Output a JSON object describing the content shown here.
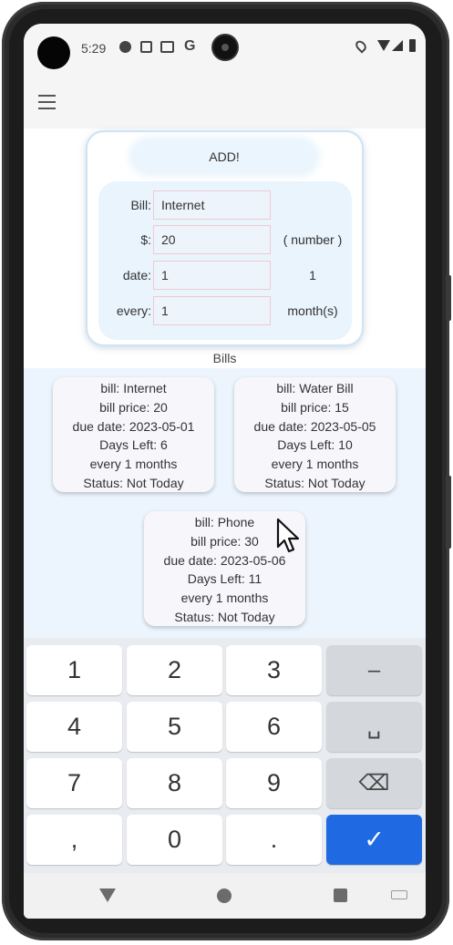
{
  "status_bar": {
    "time": "5:29",
    "google_glyph": "G"
  },
  "app_bar": {
    "menu_icon": "hamburger-menu-icon"
  },
  "add_form": {
    "button_label": "ADD!",
    "rows": [
      {
        "label": "Bill:",
        "value": "Internet",
        "hint": ""
      },
      {
        "label": "$:",
        "value": "20",
        "hint": "( number )"
      },
      {
        "label": "date:",
        "value": "1",
        "hint": "1"
      },
      {
        "label": "every:",
        "value": "1",
        "hint": "month(s)"
      }
    ]
  },
  "bills_title": "Bills",
  "bills": [
    {
      "name": "bill: Internet",
      "price": "bill price: 20",
      "due": "due date: 2023-05-01",
      "days_left": "Days Left: 6",
      "every": "every 1 months",
      "status": "Status: Not Today"
    },
    {
      "name": "bill: Water Bill",
      "price": "bill price: 15",
      "due": "due date: 2023-05-05",
      "days_left": "Days Left: 10",
      "every": "every 1 months",
      "status": "Status: Not Today"
    },
    {
      "name": "bill: Phone",
      "price": "bill price: 30",
      "due": "due date: 2023-05-06",
      "days_left": "Days Left: 11",
      "every": "every 1 months",
      "status": "Status: Not Today"
    }
  ],
  "keypad": {
    "keys": [
      "1",
      "2",
      "3",
      "–",
      "4",
      "5",
      "6",
      "␣",
      "7",
      "8",
      "9",
      "⌫",
      ",",
      "0",
      ".",
      "✓"
    ]
  },
  "colors": {
    "accent": "#1f6ae2",
    "bills_background": "#ecf5fd",
    "form_panel": "#e9f4fd"
  }
}
